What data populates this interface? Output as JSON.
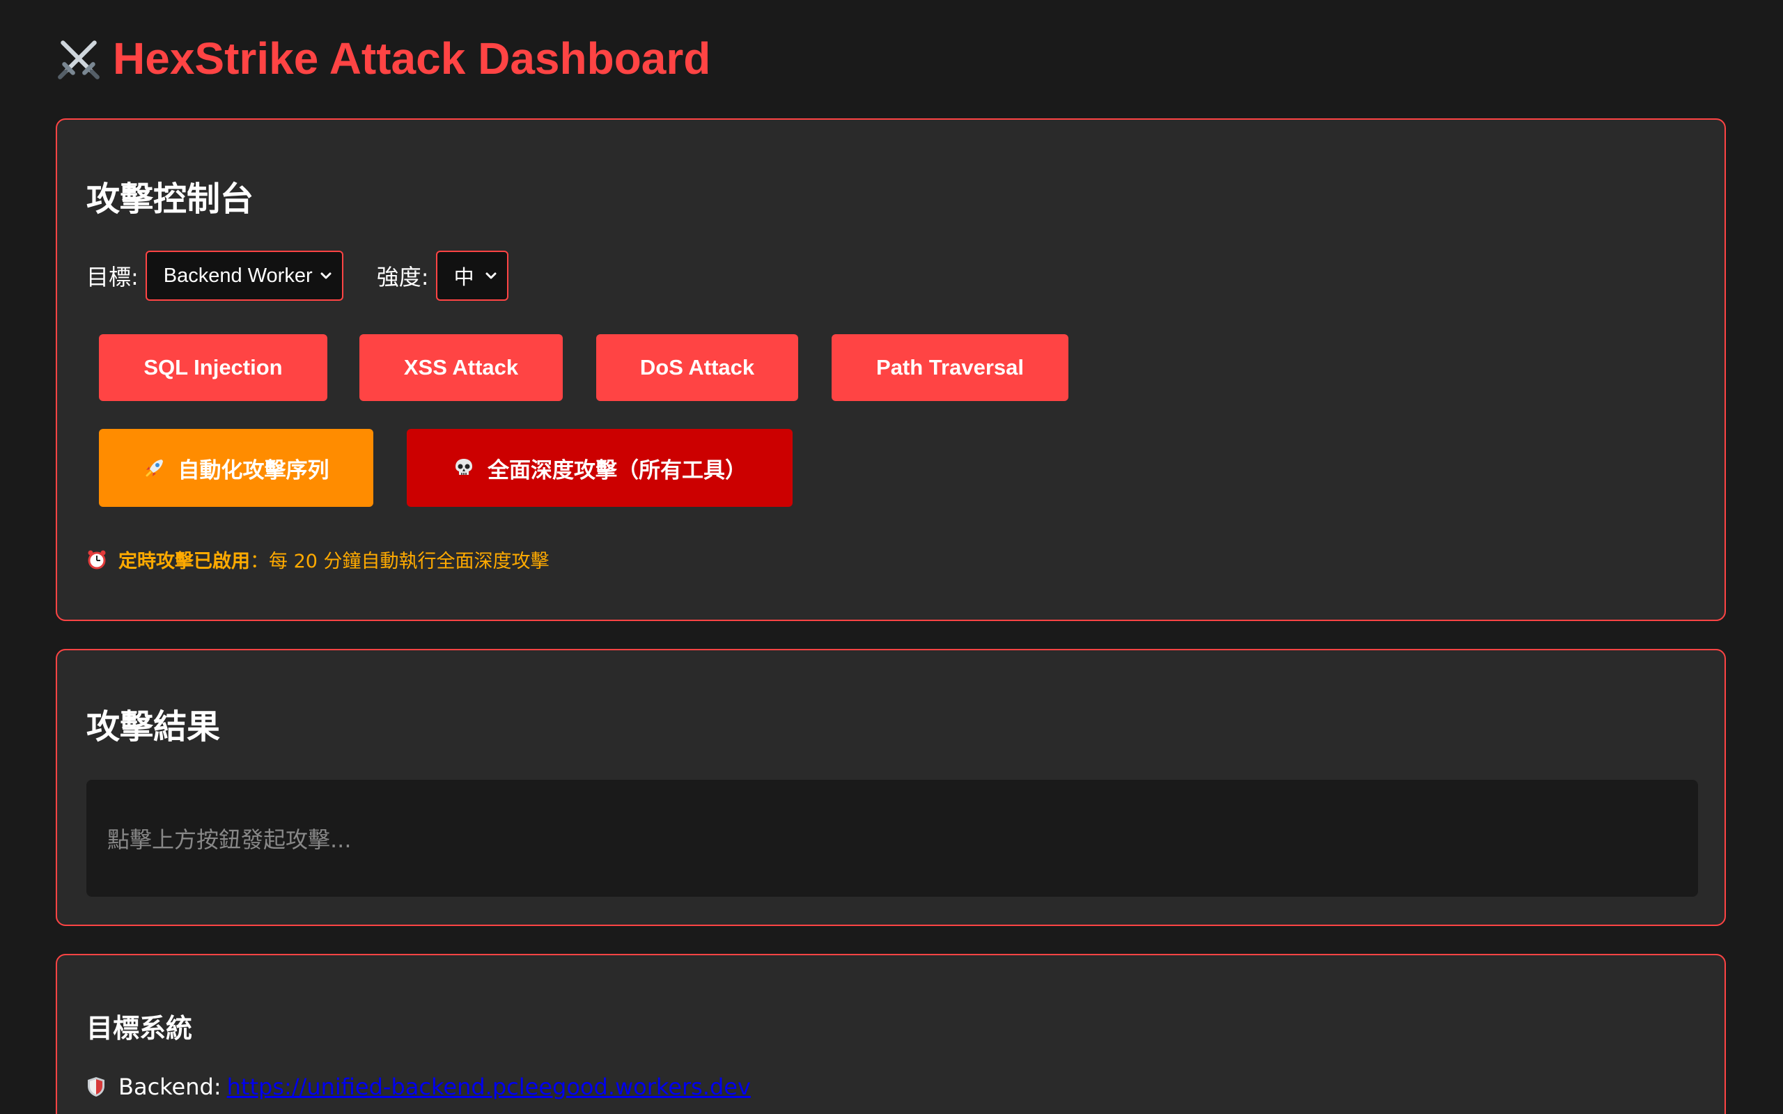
{
  "header": {
    "title": "HexStrike Attack Dashboard",
    "icon": "crossed-swords-icon"
  },
  "control": {
    "heading": "攻擊控制台",
    "target_label": "目標:",
    "target_value": "Backend Worker",
    "strength_label": "強度:",
    "strength_value": "中",
    "buttons": {
      "sql": "SQL Injection",
      "xss": "XSS Attack",
      "dos": "DoS Attack",
      "path": "Path Traversal",
      "auto": "自動化攻擊序列",
      "deep": "全面深度攻擊（所有工具）"
    },
    "schedule_strong": "定時攻擊已啟用",
    "schedule_text": "：每 20 分鐘自動執行全面深度攻擊"
  },
  "results": {
    "heading": "攻擊結果",
    "placeholder": "點擊上方按鈕發起攻擊..."
  },
  "targets": {
    "heading": "目標系統",
    "backend_label": "Backend:",
    "backend_url": "https://unified-backend.pcleegood.workers.dev"
  },
  "colors": {
    "accent": "#ff4444",
    "orange": "#ff8c00",
    "dark_red": "#cc0000",
    "warning": "#ffaa00",
    "background": "#1a1a1a",
    "card": "#2a2a2a",
    "link": "#0000ee"
  }
}
